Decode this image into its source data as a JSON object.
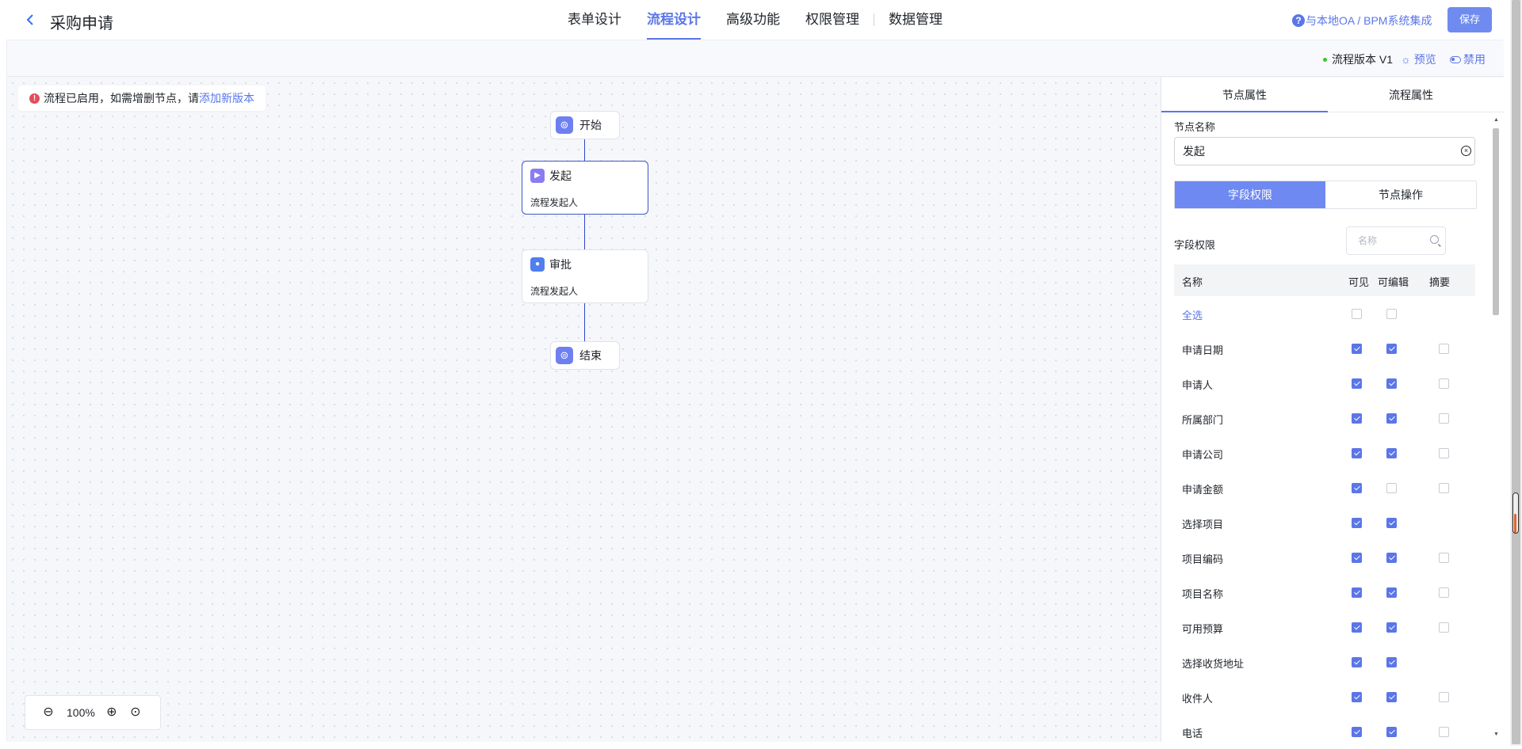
{
  "header": {
    "back_icon": "chevron-left-icon",
    "title": "采购申请",
    "tabs": [
      {
        "label": "表单设计",
        "active": false
      },
      {
        "label": "流程设计",
        "active": true
      },
      {
        "label": "高级功能",
        "active": false
      },
      {
        "label": "权限管理",
        "active": false
      },
      {
        "label": "数据管理",
        "active": false
      }
    ],
    "integrate_link": "与本地OA / BPM系统集成",
    "save_label": "保存",
    "accent_color": "#5b76e8"
  },
  "subbar": {
    "version": "流程版本 V1",
    "preview": "预览",
    "disable": "禁用"
  },
  "canvas": {
    "notice_text": "流程已启用，如需增删节点，请 ",
    "notice_link": "添加新版本",
    "nodes": {
      "start": {
        "label": "开始",
        "icon": "start-icon"
      },
      "initiate": {
        "label": "发起",
        "sub": "流程发起人",
        "icon": "play-icon"
      },
      "approve": {
        "label": "审批",
        "sub": "流程发起人",
        "icon": "user-icon"
      },
      "end": {
        "label": "结束",
        "icon": "end-icon"
      }
    },
    "zoom_level": "100%"
  },
  "panel": {
    "tabs": [
      "节点属性",
      "流程属性"
    ],
    "node_name_label": "节点名称",
    "node_name_value": "发起",
    "segments": [
      "字段权限",
      "节点操作"
    ],
    "perm_label": "字段权限",
    "search_placeholder": "名称",
    "columns": [
      "名称",
      "可见",
      "可编辑",
      "摘要"
    ],
    "rows": [
      {
        "name": "全选",
        "link": true,
        "visible": false,
        "editable": false,
        "summary": null
      },
      {
        "name": "申请日期",
        "visible": true,
        "editable": true,
        "summary": false
      },
      {
        "name": "申请人",
        "visible": true,
        "editable": true,
        "summary": false
      },
      {
        "name": "所属部门",
        "visible": true,
        "editable": true,
        "summary": false
      },
      {
        "name": "申请公司",
        "visible": true,
        "editable": true,
        "summary": false
      },
      {
        "name": "申请金额",
        "visible": true,
        "editable": false,
        "summary": false
      },
      {
        "name": "选择项目",
        "visible": true,
        "editable": true,
        "summary": null
      },
      {
        "name": "项目编码",
        "visible": true,
        "editable": true,
        "summary": false
      },
      {
        "name": "项目名称",
        "visible": true,
        "editable": true,
        "summary": false
      },
      {
        "name": "可用预算",
        "visible": true,
        "editable": true,
        "summary": false
      },
      {
        "name": "选择收货地址",
        "visible": true,
        "editable": true,
        "summary": null
      },
      {
        "name": "收件人",
        "visible": true,
        "editable": true,
        "summary": false
      },
      {
        "name": "电话",
        "visible": true,
        "editable": true,
        "summary": false
      }
    ]
  }
}
